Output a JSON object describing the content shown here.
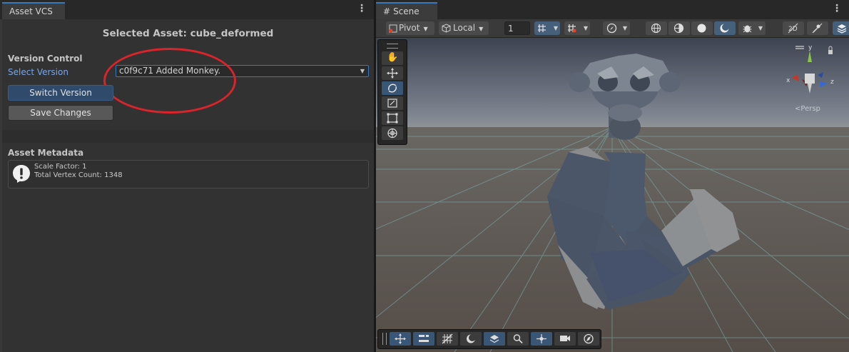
{
  "left_panel": {
    "tab_label": "Asset VCS",
    "title": "Selected Asset: cube_deformed",
    "version_control": {
      "section_label": "Version Control",
      "select_label": "Select Version",
      "selected_version": "c0f9c71 Added Monkey.",
      "switch_button": "Switch Version",
      "save_button": "Save Changes"
    },
    "metadata": {
      "section_label": "Asset Metadata",
      "lines": [
        "Scale Factor: 1",
        "Total Vertex Count: 1348"
      ]
    },
    "annotation_color": "#d8242a"
  },
  "scene_panel": {
    "tab_label": "Scene",
    "toolbar": {
      "pivot_label": "Pivot",
      "local_label": "Local",
      "grid_value": "1"
    },
    "gizmo": {
      "axis_x": "x",
      "axis_y": "y",
      "axis_z": "z",
      "persp_label": "Persp"
    },
    "accent_color": "#3a79bb"
  }
}
